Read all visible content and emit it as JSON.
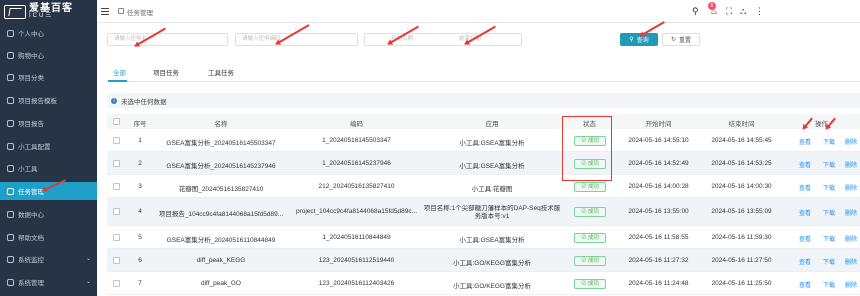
{
  "logo": {
    "title": "爱基百客",
    "subtitle": "ICU三"
  },
  "sidebar": {
    "items": [
      {
        "label": "个人中心",
        "icon": "user-icon",
        "active": false
      },
      {
        "label": "购物中心",
        "icon": "cart-icon",
        "active": false
      },
      {
        "label": "项目分类",
        "icon": "list-icon",
        "active": false
      },
      {
        "label": "项目报告模板",
        "icon": "template-icon",
        "active": false
      },
      {
        "label": "项目报告",
        "icon": "report-icon",
        "active": false
      },
      {
        "label": "小工具配置",
        "icon": "config-icon",
        "active": false
      },
      {
        "label": "小工具",
        "icon": "tool-icon",
        "active": false
      },
      {
        "label": "任务管理",
        "icon": "task-icon",
        "active": true
      },
      {
        "label": "数据中心",
        "icon": "data-icon",
        "active": false
      },
      {
        "label": "帮助文档",
        "icon": "help-icon",
        "active": false
      },
      {
        "label": "系统监控",
        "icon": "monitor-icon",
        "active": false
      },
      {
        "label": "系统管理",
        "icon": "settings-icon",
        "active": false
      }
    ]
  },
  "header": {
    "breadcrumb": "任务管理",
    "notification_count": "6"
  },
  "filters": {
    "task_name_placeholder": "请输入任务名",
    "task_code_placeholder": "请输入任务编码",
    "start_placeholder": "开始日期",
    "separator": "-",
    "end_placeholder": "结束日期",
    "search_label": "查询",
    "reset_label": "重置"
  },
  "tabs": [
    "全部",
    "项目任务",
    "工具任务"
  ],
  "info": {
    "text": "未选中任何数据"
  },
  "table": {
    "headers": [
      "序号",
      "名称",
      "编码",
      "应用",
      "状态",
      "开始时间",
      "结束时间",
      "操作"
    ],
    "rows": [
      {
        "no": "1",
        "name": "GSEA富集分析_20240516145503347",
        "code": "1_20240516145503347",
        "app": "小工具:GSEA富集分析",
        "status": "成功",
        "start": "2024-05-16 14:55:10",
        "end": "2024-05-16 14:55:45"
      },
      {
        "no": "2",
        "name": "GSEA富集分析_20240516145237946",
        "code": "1_20240516145237946",
        "app": "小工具:GSEA富集分析",
        "status": "成功",
        "start": "2024-05-16 14:52:49",
        "end": "2024-05-16 14:53:25"
      },
      {
        "no": "3",
        "name": "花瓣图_20240516135827410",
        "code": "212_20240516135827410",
        "app": "小工具:花瓣图",
        "status": "成功",
        "start": "2024-05-16 14:00:28",
        "end": "2024-05-16 14:00:30"
      },
      {
        "no": "4",
        "name": "项目报告_104cc9c4fa8144068a15fd5d89...",
        "code": "project_104cc9c4fa8144068a15fd5d89c...",
        "app": "项目名称:1个尖部糖刀藩样本的DAP-Seq技术服务版本号:v1",
        "status": "成功",
        "start": "2024-05-16 13:55:00",
        "end": "2024-05-16 13:55:09"
      },
      {
        "no": "5",
        "name": "GSEA富集分析_20240516110844849",
        "code": "1_20240516110844849",
        "app": "小工具:GSEA富集分析",
        "status": "成功",
        "start": "2024-05-16 11:58:55",
        "end": "2024-05-16 11:59:30"
      },
      {
        "no": "6",
        "name": "diff_peak_KEGG",
        "code": "123_20240516112519440",
        "app": "小工具:GO/KEGG富集分析",
        "status": "成功",
        "start": "2024-05-16 11:27:32",
        "end": "2024-05-16 11:27:50"
      },
      {
        "no": "7",
        "name": "diff_peak_GO",
        "code": "123_20240516112403426",
        "app": "小工具:GO/KEGG富集分析",
        "status": "成功",
        "start": "2024-05-16 11:24:48",
        "end": "2024-05-16 11:25:50"
      }
    ],
    "actions": [
      "查看",
      "下载",
      "删除"
    ]
  }
}
